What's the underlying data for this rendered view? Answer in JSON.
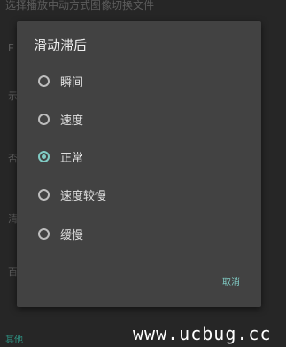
{
  "background": {
    "top_text": "选择播放中动方式图像切换文件",
    "bottom_text": "其他",
    "side_glyphs": [
      "E",
      "示",
      "否",
      "清",
      "百"
    ]
  },
  "dialog": {
    "title": "滑动滞后",
    "options": [
      {
        "label": "瞬间",
        "selected": false
      },
      {
        "label": "速度",
        "selected": false
      },
      {
        "label": "正常",
        "selected": true
      },
      {
        "label": "速度较慢",
        "selected": false
      },
      {
        "label": "缓慢",
        "selected": false
      }
    ],
    "cancel_label": "取消"
  },
  "watermark": "www.ucbug.cc",
  "colors": {
    "accent": "#80cbc4",
    "dialog_bg": "#424242",
    "screen_bg": "#262626"
  }
}
